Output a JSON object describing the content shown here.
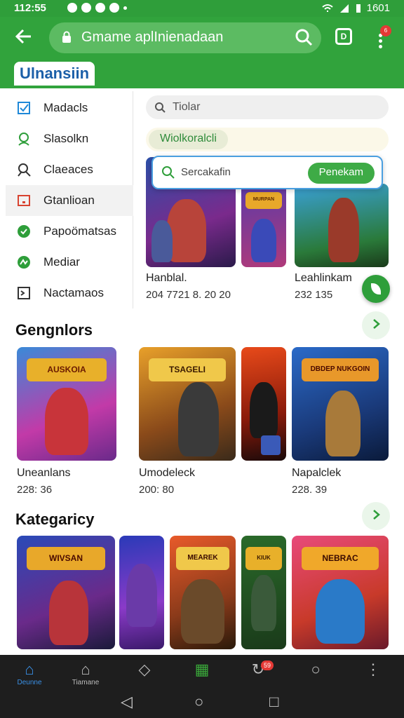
{
  "status": {
    "time": "112:55",
    "battery": "1601"
  },
  "browser": {
    "url": "Gmame aplInienadaan",
    "tab_count": "D",
    "menu_badge": "6",
    "site_title": "Ulnansiin"
  },
  "sidebar": {
    "items": [
      {
        "label": "Madacls",
        "icon": "checkbox-icon"
      },
      {
        "label": "Slasolkn",
        "icon": "user-icon"
      },
      {
        "label": "Claeaces",
        "icon": "search-user-icon"
      },
      {
        "label": "Gtanlioan",
        "icon": "square-icon"
      },
      {
        "label": "Papoömatsas",
        "icon": "check-circle-icon"
      },
      {
        "label": "Mediar",
        "icon": "game-icon"
      },
      {
        "label": "Nactamaos",
        "icon": "terminal-icon"
      }
    ]
  },
  "search": {
    "placeholder": "Tiolar"
  },
  "chip": {
    "label": "Wiolkoralcli"
  },
  "popup": {
    "placeholder": "Sercakafin",
    "button": "Penekam"
  },
  "featured": [
    {
      "title": "Hanblal.",
      "meta": "204 7721 8. 20 20"
    },
    {
      "title": "Leahlinkam",
      "meta": "232 135"
    }
  ],
  "sections": [
    {
      "title": "Gengnlors",
      "items": [
        {
          "title": "Uneanlans",
          "meta": "228: 36"
        },
        {
          "title": "Umodeleck",
          "meta": "200: 80"
        },
        {
          "title": "Napalclek",
          "meta": "228. 39"
        }
      ]
    },
    {
      "title": "Kategaricy"
    }
  ],
  "tile_logos": {
    "featured_small": "MURPAN",
    "sec1_tile1": "AUSKOIA",
    "sec1_tile2": "TSAGELI",
    "sec1_tile4": "DBDEP NUKGOIN",
    "sec2_tile1": "WIVSAN",
    "sec2_tile3": "MEAREK",
    "sec2_tile4": "KIUK",
    "sec2_tile5": "NEBRAC"
  },
  "bottom_nav": [
    {
      "label": "Deunne",
      "icon": "home-icon",
      "active": true
    },
    {
      "label": "Tiamane",
      "icon": "home-icon"
    },
    {
      "label": "",
      "icon": "cube-icon"
    },
    {
      "label": "",
      "icon": "grid-icon"
    },
    {
      "label": "",
      "icon": "refresh-icon",
      "badge": "59"
    },
    {
      "label": "",
      "icon": "search-icon"
    },
    {
      "label": "",
      "icon": "more-icon"
    }
  ],
  "colors": {
    "brand_green": "#31a33c",
    "link_blue": "#1b5fa8",
    "accent_red": "#e53935"
  }
}
